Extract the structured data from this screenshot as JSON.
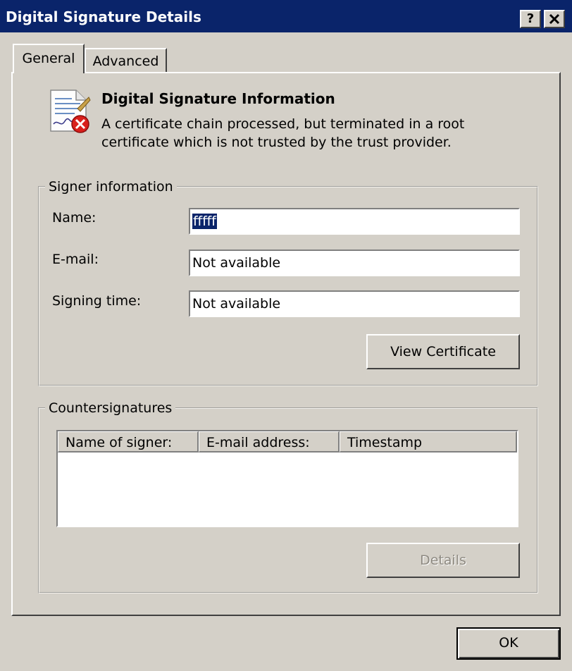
{
  "window": {
    "title": "Digital Signature Details",
    "help_button": "?",
    "close_button": "✕"
  },
  "tabs": [
    {
      "label": "General",
      "active": true
    },
    {
      "label": "Advanced",
      "active": false
    }
  ],
  "info": {
    "icon": "signature-error-icon",
    "title": "Digital Signature Information",
    "text": "A certificate chain processed, but terminated in a root certificate which is not trusted by the trust provider."
  },
  "signer": {
    "group_label": "Signer information",
    "name_label": "Name:",
    "name_value": "fffff",
    "email_label": "E-mail:",
    "email_value": "Not available",
    "time_label": "Signing time:",
    "time_value": "Not available",
    "view_cert_button": "View Certificate"
  },
  "countersignatures": {
    "group_label": "Countersignatures",
    "columns": [
      "Name of signer:",
      "E-mail address:",
      "Timestamp"
    ],
    "rows": [],
    "details_button": "Details"
  },
  "footer": {
    "ok_button": "OK"
  },
  "colors": {
    "titlebar": "#0a246a",
    "dialog_face": "#d4d0c8",
    "error_red": "#d9201c"
  }
}
